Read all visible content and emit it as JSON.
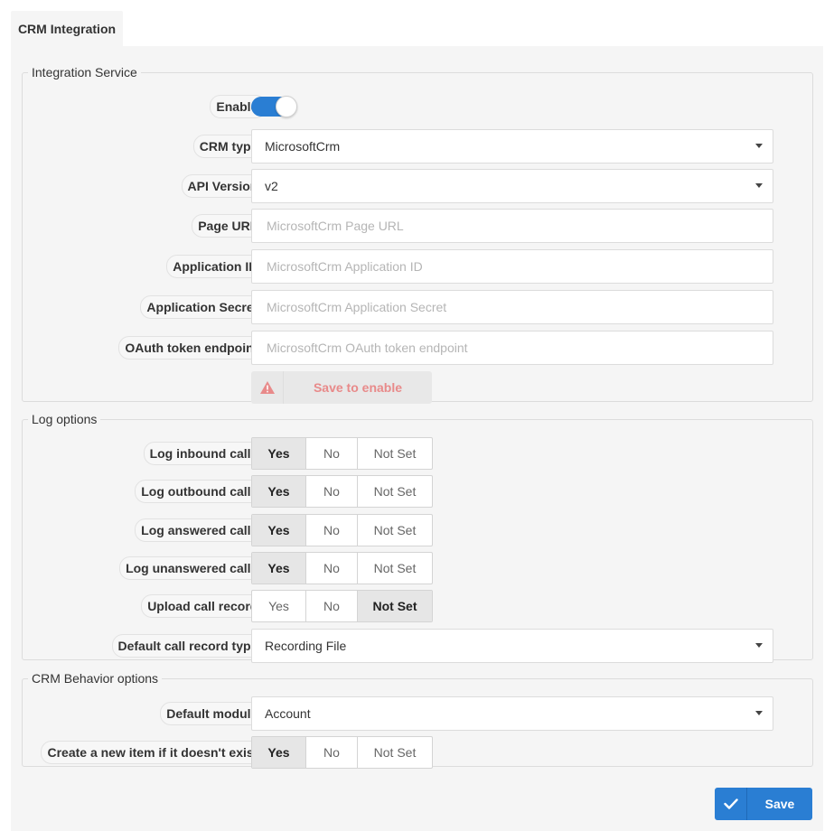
{
  "tab": {
    "label": "CRM Integration"
  },
  "integration": {
    "legend": "Integration Service",
    "enable": {
      "label": "Enable:",
      "on": true
    },
    "crm_type": {
      "label": "CRM type:",
      "value": "MicrosoftCrm"
    },
    "api_version": {
      "label": "API Version:",
      "value": "v2"
    },
    "page_url": {
      "label": "Page URL:",
      "placeholder": "MicrosoftCrm Page URL"
    },
    "application_id": {
      "label": "Application ID:",
      "placeholder": "MicrosoftCrm Application ID"
    },
    "application_secret": {
      "label": "Application Secret:",
      "placeholder": "MicrosoftCrm Application Secret"
    },
    "oauth": {
      "label": "OAuth token endpoint:",
      "placeholder": "MicrosoftCrm OAuth token endpoint"
    },
    "save_to_enable": {
      "label": "Save to enable",
      "icon": "warning-icon",
      "color": "#e88a8a"
    }
  },
  "log_options": {
    "legend": "Log options",
    "options": [
      "Yes",
      "No",
      "Not Set"
    ],
    "rows": [
      {
        "label": "Log inbound calls:",
        "selected": "Yes"
      },
      {
        "label": "Log outbound calls:",
        "selected": "Yes"
      },
      {
        "label": "Log answered calls:",
        "selected": "Yes"
      },
      {
        "label": "Log unanswered calls:",
        "selected": "Yes"
      },
      {
        "label": "Upload call record:",
        "selected": "Not Set"
      }
    ],
    "default_record_type": {
      "label": "Default call record type:",
      "value": "Recording File"
    }
  },
  "behavior": {
    "legend": "CRM Behavior options",
    "default_module": {
      "label": "Default module:",
      "value": "Account"
    },
    "create_new": {
      "label": "Create a new item if it doesn't exist:",
      "selected": "Yes"
    }
  },
  "footer": {
    "save_label": "Save",
    "accent": "#2a7ed3"
  }
}
